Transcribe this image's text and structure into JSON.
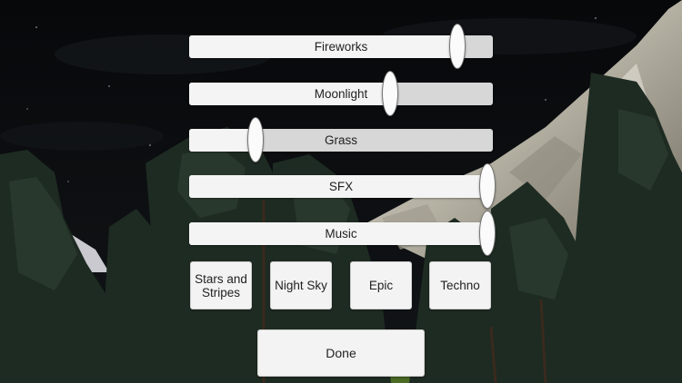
{
  "sliders": [
    {
      "label": "Fireworks",
      "value": 0.88
    },
    {
      "label": "Moonlight",
      "value": 0.66
    },
    {
      "label": "Grass",
      "value": 0.215
    },
    {
      "label": "SFX",
      "value": 0.98
    },
    {
      "label": "Music",
      "value": 0.98
    }
  ],
  "presets": {
    "stars_and_stripes": "Stars and Stripes",
    "night_sky": "Night Sky",
    "epic": "Epic",
    "techno": "Techno"
  },
  "done_label": "Done"
}
